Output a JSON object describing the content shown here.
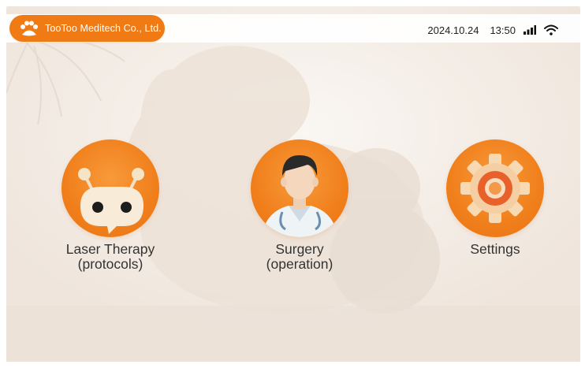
{
  "header": {
    "brand": "TooToo Meditech Co., Ltd.",
    "date": "2024.10.24",
    "time": "13:50",
    "icons": [
      "paw-logo-icon",
      "signal-strength-icon",
      "wifi-icon"
    ]
  },
  "menu": [
    {
      "id": "laser",
      "icon": "robot-face-icon",
      "label": "Laser Therapy\n(protocols)"
    },
    {
      "id": "surgery",
      "icon": "doctor-avatar-icon",
      "label": "Surgery\n(operation)"
    },
    {
      "id": "settings",
      "icon": "gear-icon",
      "label": "Settings"
    }
  ],
  "colors": {
    "accent": "#f07b14",
    "text": "#333333",
    "background": "#f5efe9"
  }
}
